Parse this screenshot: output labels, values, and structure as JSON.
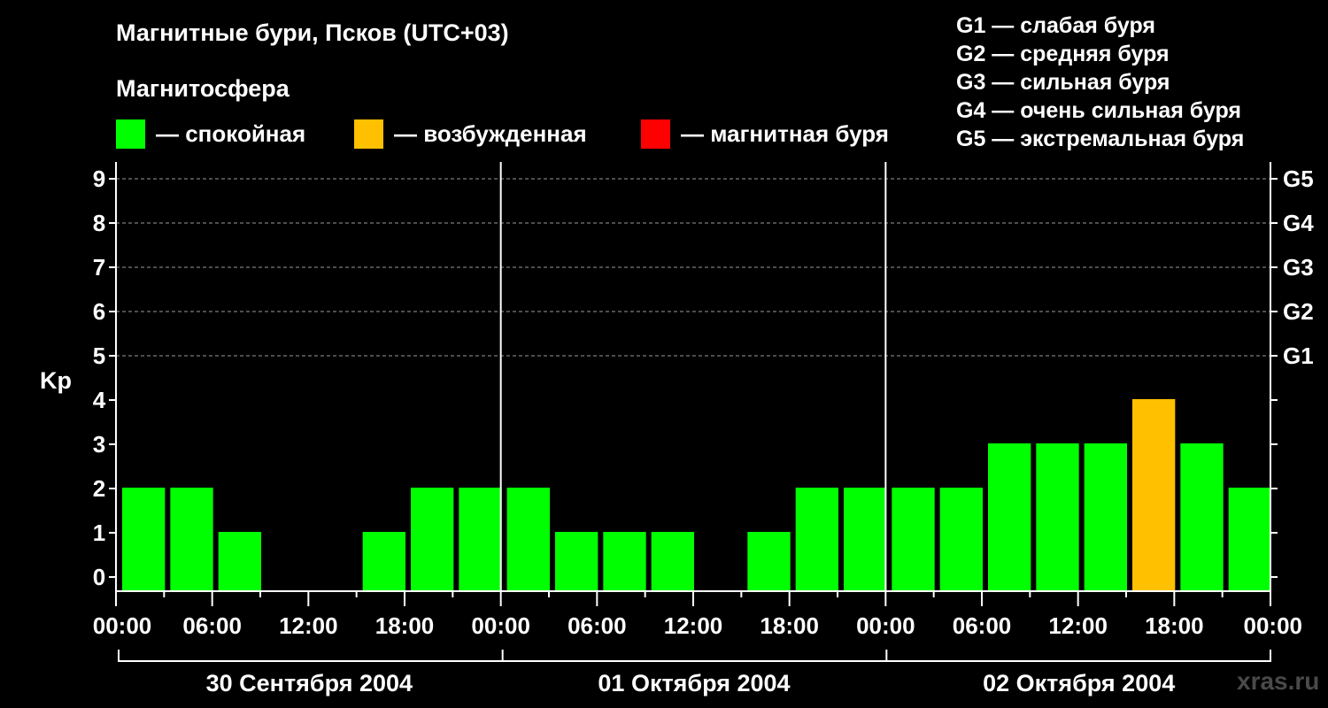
{
  "header": {
    "title": "Магнитные бури, Псков (UTC+03)",
    "subtitle": "Магнитосфера"
  },
  "legend": {
    "quiet": {
      "label": "— спокойная",
      "color": "#00ff00"
    },
    "excited": {
      "label": "— возбужденная",
      "color": "#ffc000"
    },
    "storm": {
      "label": "— магнитная буря",
      "color": "#ff0000"
    }
  },
  "g_scale": [
    "G1 — слабая буря",
    "G2 — средняя буря",
    "G3 — сильная буря",
    "G4 — очень сильная буря",
    "G5 — экстремальная буря"
  ],
  "watermark": "xras.ru",
  "chart_data": {
    "type": "bar",
    "ylabel": "Kp",
    "ylim": [
      0,
      9
    ],
    "y_ticks": [
      "0",
      "1",
      "2",
      "3",
      "4",
      "5",
      "6",
      "7",
      "8",
      "9"
    ],
    "right_ticks": [
      {
        "kp": 5,
        "label": "G1"
      },
      {
        "kp": 6,
        "label": "G2"
      },
      {
        "kp": 7,
        "label": "G3"
      },
      {
        "kp": 8,
        "label": "G4"
      },
      {
        "kp": 9,
        "label": "G5"
      }
    ],
    "x_tick_labels": [
      "00:00",
      "06:00",
      "12:00",
      "18:00",
      "00:00",
      "06:00",
      "12:00",
      "18:00",
      "00:00",
      "06:00",
      "12:00",
      "18:00",
      "00:00"
    ],
    "days": [
      "30 Сентября 2004",
      "01 Октября 2004",
      "02 Октября 2004"
    ],
    "grid": "horizontal dashed at Kp 5–9",
    "series": [
      {
        "values": [
          2,
          2,
          1,
          0,
          0,
          1,
          2,
          2,
          2,
          1,
          1,
          1,
          0,
          1,
          2,
          2,
          2,
          2,
          3,
          3,
          3,
          4,
          3,
          2
        ]
      }
    ]
  }
}
